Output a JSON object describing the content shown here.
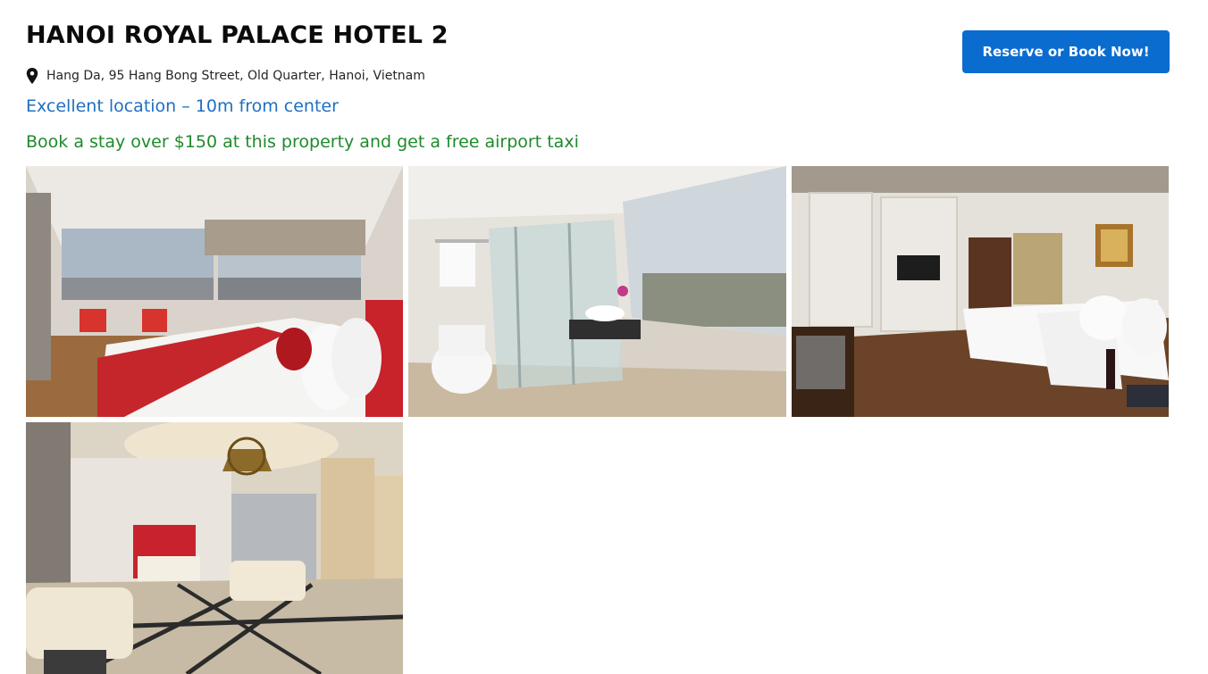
{
  "hotel": {
    "name": "HANOI ROYAL PALACE HOTEL 2",
    "address": "Hang Da, 95 Hang Bong Street, Old Quarter, Hanoi, Vietnam",
    "location_note": "Excellent location – 10m from center",
    "promo": "Book a stay over $150 at this property and get a free airport taxi"
  },
  "actions": {
    "reserve_label": "Reserve or Book Now!"
  },
  "icons": {
    "address": "map-pin-icon"
  },
  "colors": {
    "button": "#0a6ccf",
    "location": "#1f6fc0",
    "promo": "#1e8a2c"
  },
  "gallery": [
    {
      "subject": "room-with-city-view"
    },
    {
      "subject": "bathroom-with-glass-shower"
    },
    {
      "subject": "room-with-double-bed"
    },
    {
      "subject": "lobby-with-chandelier"
    }
  ]
}
